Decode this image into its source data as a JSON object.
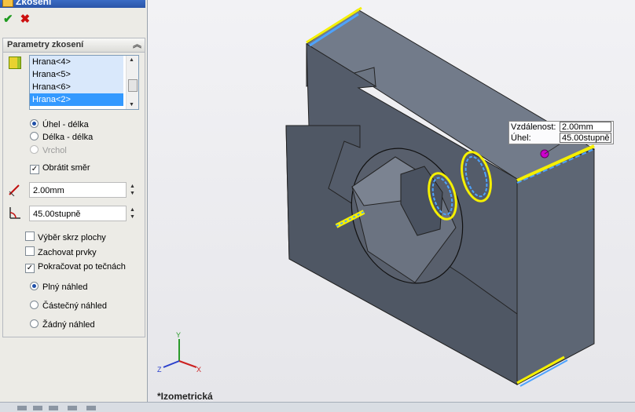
{
  "panel": {
    "title": "Zkosení",
    "ok_symbol": "✔",
    "cancel_symbol": "✖",
    "group_title": "Parametry zkosení",
    "edges": [
      {
        "label": "Hrana<4>",
        "selected": false
      },
      {
        "label": "Hrana<5>",
        "selected": false
      },
      {
        "label": "Hrana<6>",
        "selected": false
      },
      {
        "label": "Hrana<2>",
        "selected": true
      }
    ],
    "modes": [
      {
        "label": "Úhel - délka",
        "checked": true,
        "enabled": true
      },
      {
        "label": "Délka - délka",
        "checked": false,
        "enabled": true
      },
      {
        "label": "Vrchol",
        "checked": false,
        "enabled": false
      }
    ],
    "flip_label": "Obrátit směr",
    "flip_checked": true,
    "distance_value": "2.00mm",
    "angle_value": "45.00stupně",
    "distance_icon_letter": "D",
    "angle_icon_letter": "A",
    "options": [
      {
        "label": "Výběr skrz plochy",
        "checked": false
      },
      {
        "label": "Zachovat prvky",
        "checked": false
      },
      {
        "label": "Pokračovat po tečnách",
        "checked": true
      }
    ],
    "previews": [
      {
        "label": "Plný náhled",
        "checked": true
      },
      {
        "label": "Částečný náhled",
        "checked": false
      },
      {
        "label": "Žádný náhled",
        "checked": false
      }
    ]
  },
  "viewport": {
    "view_name": "*Izometrická",
    "callout": {
      "distance_label": "Vzdálenost:",
      "distance_value": "2.00mm",
      "angle_label": "Úhel:",
      "angle_value": "45.00stupně"
    },
    "triad": {
      "x": "X",
      "y": "Y",
      "z": "Z"
    }
  },
  "colors": {
    "accent_blue": "#3399ff",
    "edge_highlight": "#f5f000",
    "model_face": "#606a78"
  }
}
